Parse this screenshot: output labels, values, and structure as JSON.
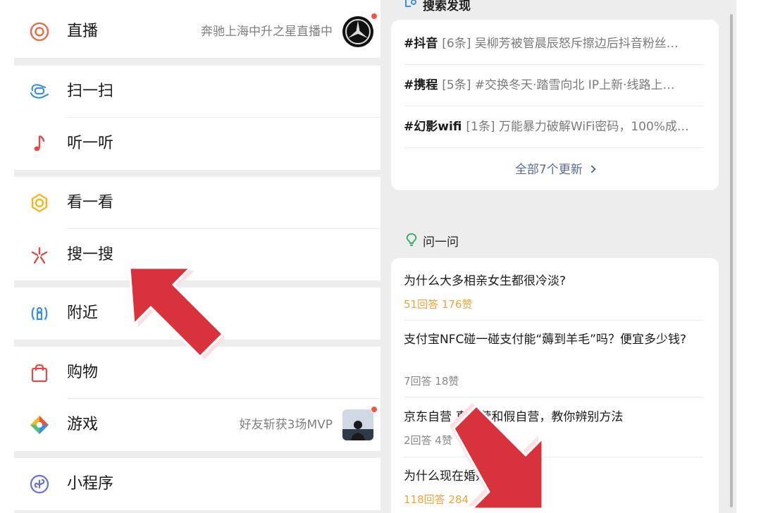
{
  "discover": {
    "live": {
      "label": "直播",
      "right_text": "奔驰上海中升之星直播中",
      "icon": "live-icon",
      "thumb": "mercedes-logo"
    },
    "scan": {
      "label": "扫一扫",
      "icon": "scan-icon"
    },
    "listen": {
      "label": "听一听",
      "icon": "music-note-icon"
    },
    "look": {
      "label": "看一看",
      "icon": "look-icon"
    },
    "search": {
      "label": "搜一搜",
      "icon": "search-spark-icon"
    },
    "nearby": {
      "label": "附近",
      "icon": "nearby-icon"
    },
    "shopping": {
      "label": "购物",
      "icon": "shopping-bag-icon"
    },
    "games": {
      "label": "游戏",
      "right_text": "好友斩获3场MVP",
      "icon": "game-icon"
    },
    "mini_programs": {
      "label": "小程序",
      "icon": "mini-program-icon"
    }
  },
  "search_discovery": {
    "title": "搜索发现",
    "items": [
      {
        "tag": "#抖音",
        "count": "[6条]",
        "text": "吴柳芳被管晨辰怒斥擦边后抖音粉丝…"
      },
      {
        "tag": "#携程",
        "count": "[5条]",
        "text": "#交换冬天·踏雪向北 IP上新·线路上…"
      },
      {
        "tag": "#幻影wifi",
        "count": "[1条]",
        "text": "万能暴力破解WiFi密码，100%成…"
      }
    ],
    "more": "全部7个更新"
  },
  "ask": {
    "title": "问一问",
    "questions": [
      {
        "title": "为什么大多相亲女生都很冷淡?",
        "meta": "51回答 176赞"
      },
      {
        "title": "支付宝NFC碰一碰支付能“薅到羊毛”吗？便宜多少钱?",
        "meta": "7回答 18赞"
      },
      {
        "title": "京东自营 真自营和假自营，教你辨别方法",
        "meta": "2回答 4赞"
      },
      {
        "title": "为什么现在婚姻 幸福?",
        "meta": "118回答 284"
      }
    ]
  },
  "colors": {
    "arrow_red": "#d8323c",
    "link_blue": "#576b95",
    "meta_orange": "#f0a33a",
    "badge_red": "#f25643"
  }
}
